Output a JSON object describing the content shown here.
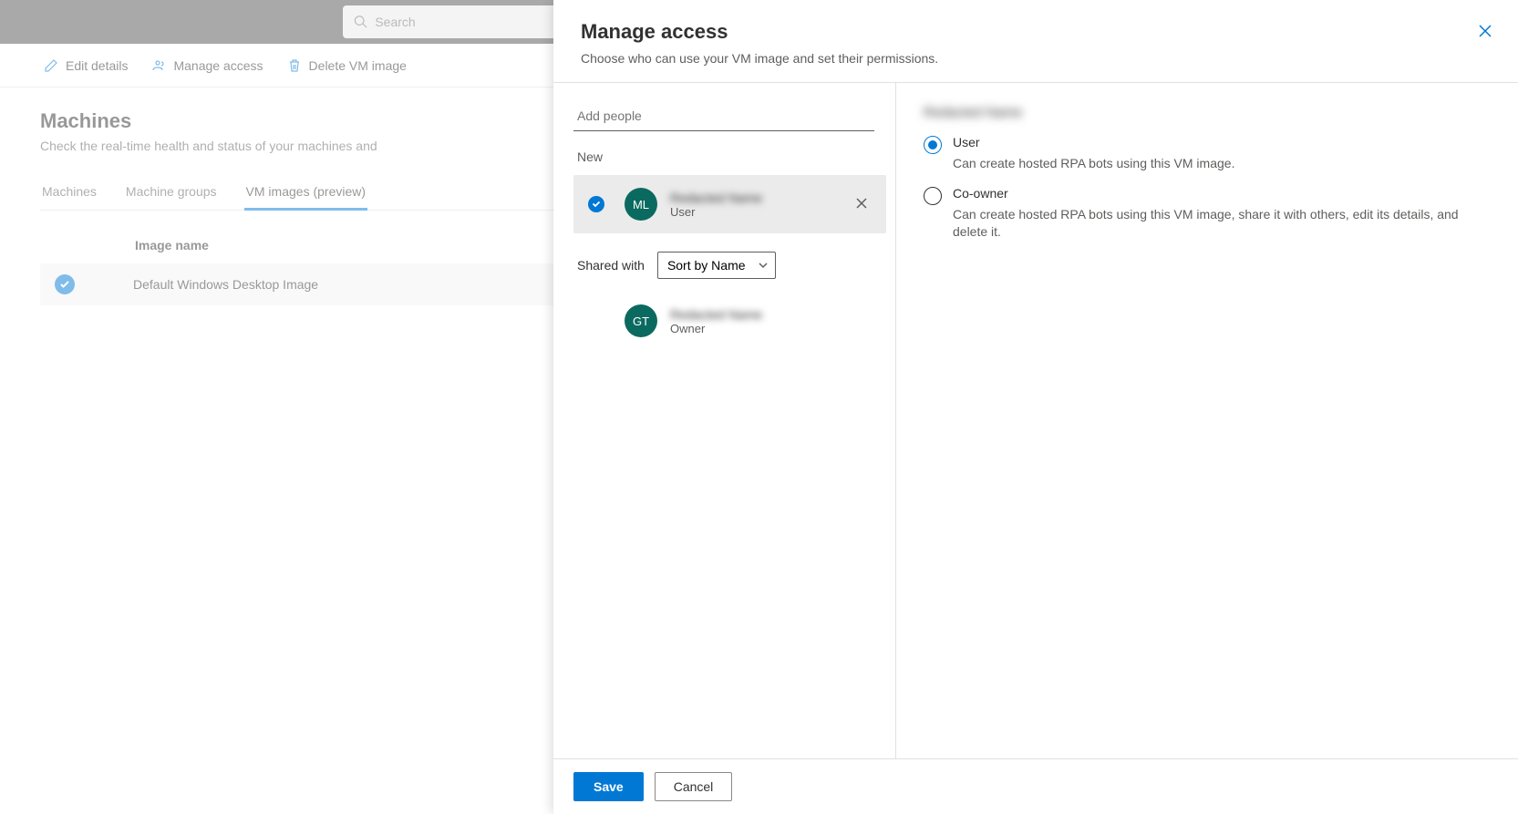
{
  "search": {
    "placeholder": "Search"
  },
  "commandBar": {
    "editDetails": "Edit details",
    "manageAccess": "Manage access",
    "deleteVmImage": "Delete VM image"
  },
  "page": {
    "title": "Machines",
    "subtitle": "Check the real-time health and status of your machines and"
  },
  "tabs": [
    {
      "label": "Machines",
      "active": false
    },
    {
      "label": "Machine groups",
      "active": false
    },
    {
      "label": "VM images (preview)",
      "active": true
    }
  ],
  "table": {
    "header": "Image name",
    "rows": [
      {
        "name": "Default Windows Desktop Image",
        "selected": true
      }
    ]
  },
  "panel": {
    "title": "Manage access",
    "subtitle": "Choose who can use your VM image and set their permissions.",
    "addPlaceholder": "Add people",
    "newLabel": "New",
    "sharedWithLabel": "Shared with",
    "sortByLabel": "Sort by Name",
    "newPeople": [
      {
        "initials": "ML",
        "name": "Redacted Name",
        "role": "User",
        "selected": true
      }
    ],
    "sharedPeople": [
      {
        "initials": "GT",
        "name": "Redacted Name",
        "role": "Owner"
      }
    ],
    "selectedPersonName": "Redacted Name",
    "permissions": [
      {
        "label": "User",
        "description": "Can create hosted RPA bots using this VM image.",
        "selected": true
      },
      {
        "label": "Co-owner",
        "description": "Can create hosted RPA bots using this VM image, share it with others, edit its details, and delete it.",
        "selected": false
      }
    ],
    "saveLabel": "Save",
    "cancelLabel": "Cancel"
  }
}
